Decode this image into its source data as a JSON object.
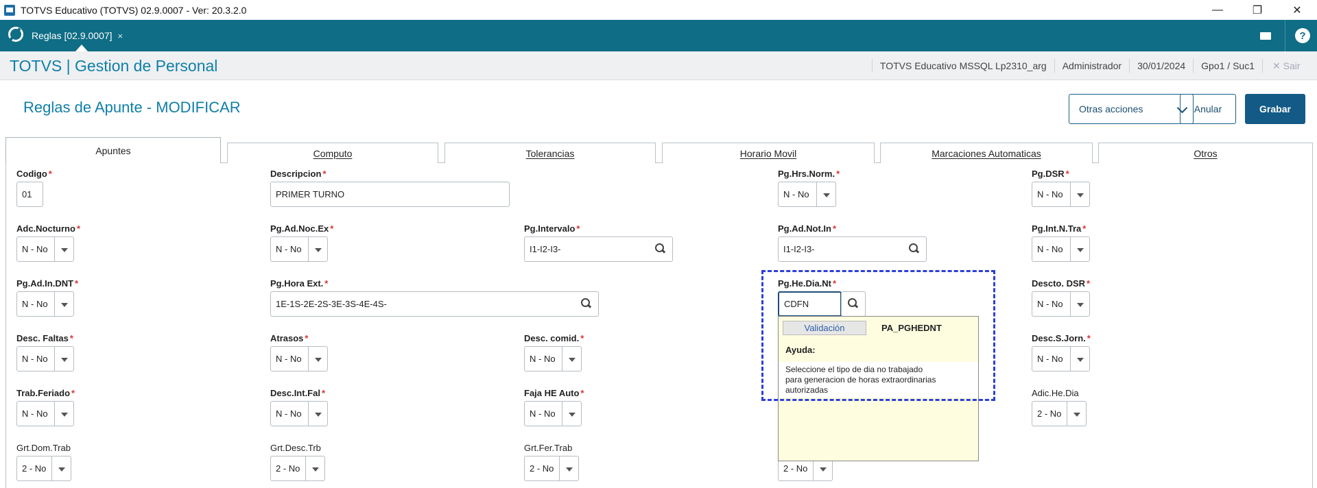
{
  "window": {
    "title": "TOTVS Educativo (TOTVS) 02.9.0007 - Ver: 20.3.2.0",
    "controls": [
      "—",
      "❐",
      "✕"
    ]
  },
  "appbar": {
    "tab_label": "Reglas [02.9.0007]",
    "tab_close": "×",
    "help": "?"
  },
  "module": {
    "title": "TOTVS | Gestion de Personal",
    "environment": "TOTVS Educativo MSSQL Lp2310_arg",
    "user": "Administrador",
    "date": "30/01/2024",
    "branch": "Gpo1 / Suc1",
    "exit_label": "✕  Sair"
  },
  "page": {
    "title": "Reglas de Apunte - MODIFICAR",
    "otras_acciones": "Otras acciones",
    "anular": "Anular",
    "grabar": "Grabar"
  },
  "tabs": [
    "Apuntes",
    "Computo",
    "Tolerancias",
    "Horario Movil",
    "Marcaciones Automaticas",
    "Otros"
  ],
  "required_mark": "*",
  "fields": {
    "codigo": {
      "label": "Codigo",
      "value": "01"
    },
    "descripcion": {
      "label": "Descripcion",
      "value": "PRIMER TURNO"
    },
    "pg_hrs_norm": {
      "label": "Pg.Hrs.Norm.",
      "value": "N - No"
    },
    "pg_dsr": {
      "label": "Pg.DSR",
      "value": "N - No"
    },
    "adc_nocturno": {
      "label": "Adc.Nocturno",
      "value": "N - No"
    },
    "pg_ad_noc_ex": {
      "label": "Pg.Ad.Noc.Ex",
      "value": "N - No"
    },
    "pg_intervalo": {
      "label": "Pg.Intervalo",
      "value": "I1-I2-I3-"
    },
    "pg_ad_not_in": {
      "label": "Pg.Ad.Not.In",
      "value": "I1-I2-I3-"
    },
    "pg_int_n_tra": {
      "label": "Pg.Int.N.Tra",
      "value": "N - No"
    },
    "pg_ad_in_dnt": {
      "label": "Pg.Ad.In.DNT",
      "value": "N - No"
    },
    "pg_hora_ext": {
      "label": "Pg.Hora Ext.",
      "value": "1E-1S-2E-2S-3E-3S-4E-4S-"
    },
    "pg_he_dia_nt": {
      "label": "Pg.He.Dia.Nt",
      "value": "CDFN"
    },
    "descto_dsr": {
      "label": "Descto. DSR",
      "value": "N - No"
    },
    "desc_faltas": {
      "label": "Desc. Faltas",
      "value": "N - No"
    },
    "atrasos": {
      "label": "Atrasos",
      "value": "N - No"
    },
    "desc_comid": {
      "label": "Desc. comid.",
      "value": "N - No"
    },
    "desc_s_jorn": {
      "label": "Desc.S.Jorn.",
      "value": "N - No"
    },
    "trab_feriado": {
      "label": "Trab.Feriado",
      "value": "N - No"
    },
    "desc_int_fal": {
      "label": "Desc.Int.Fal",
      "value": "N - No"
    },
    "faja_he_auto": {
      "label": "Faja HE Auto",
      "value": "N - No"
    },
    "adic_he_dia": {
      "label": "Adic.He.Dia",
      "value": "2 - No"
    },
    "grt_dom_trab": {
      "label": "Grt.Dom.Trab",
      "value": "2 - No"
    },
    "grt_desc_trb": {
      "label": "Grt.Desc.Trb",
      "value": "2 - No"
    },
    "grt_fer_trab": {
      "label": "Grt.Fer.Trab",
      "value": "2 - No"
    },
    "hidden_bottom": {
      "value": "2 - No"
    }
  },
  "tooltip": {
    "tab": "Validación",
    "code": "PA_PGHEDNT",
    "help_label": "Ayuda:",
    "help_line1": "Seleccione el tipo de dia no trabajado",
    "help_line2": "para generacion de horas extraordinarias",
    "help_line3": "autorizadas"
  }
}
